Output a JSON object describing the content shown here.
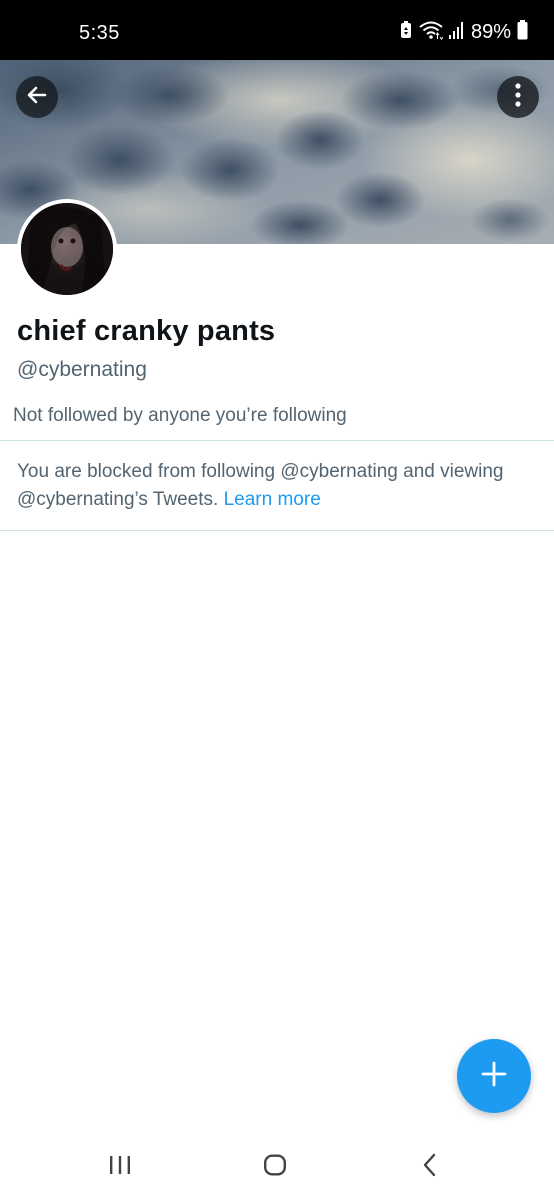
{
  "status_bar": {
    "time": "5:35",
    "battery": "89%",
    "icons": [
      "battery-saver-icon",
      "wifi-icon",
      "signal-icon",
      "battery-icon"
    ]
  },
  "header": {
    "back_icon": "arrow-left-icon",
    "more_icon": "more-vertical-icon"
  },
  "profile": {
    "display_name": "chief cranky pants",
    "handle": "@cybernating",
    "followers_note": "Not followed by anyone you’re following"
  },
  "blocked": {
    "message": "You are blocked from following @cybernating and viewing @cybernating’s Tweets.",
    "link": "Learn more"
  },
  "fab": {
    "icon": "plus-icon"
  },
  "nav": {
    "icons": [
      "recent-apps-icon",
      "home-icon",
      "back-icon"
    ]
  },
  "colors": {
    "accent": "#1d9bf0",
    "text_primary": "#0f1419",
    "text_secondary": "#536471",
    "divider": "#cfe3e8"
  }
}
